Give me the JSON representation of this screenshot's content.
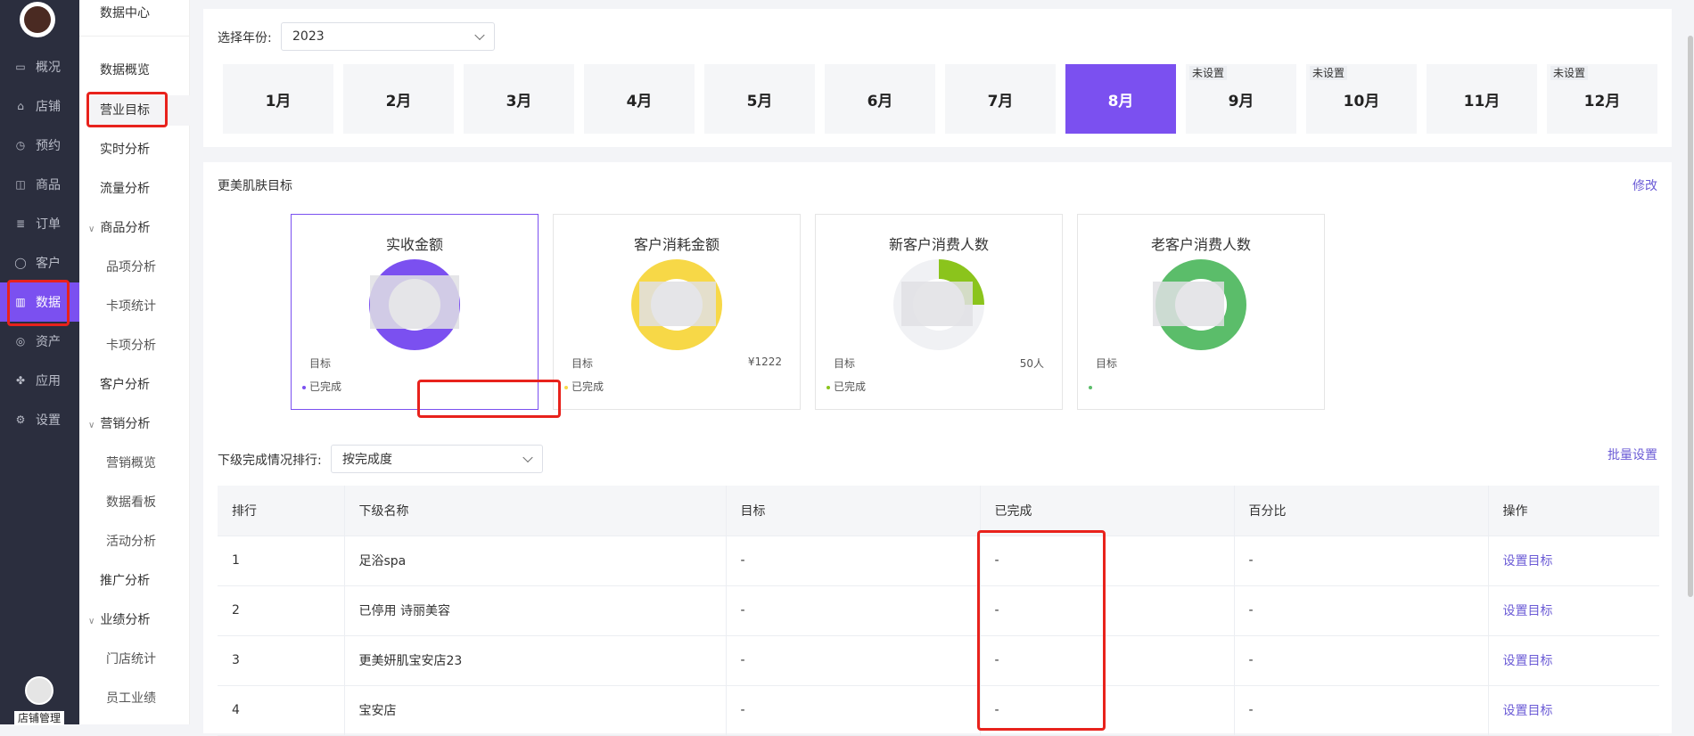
{
  "nav": {
    "items": [
      {
        "label": "概况",
        "icon": "monitor-icon"
      },
      {
        "label": "店铺",
        "icon": "store-icon"
      },
      {
        "label": "预约",
        "icon": "calendar-icon"
      },
      {
        "label": "商品",
        "icon": "bag-icon"
      },
      {
        "label": "订单",
        "icon": "order-icon"
      },
      {
        "label": "客户",
        "icon": "user-icon"
      },
      {
        "label": "数据",
        "icon": "chart-icon"
      },
      {
        "label": "资产",
        "icon": "money-icon"
      },
      {
        "label": "应用",
        "icon": "apps-icon"
      },
      {
        "label": "设置",
        "icon": "gear-icon"
      }
    ],
    "shop_label": "店铺管理"
  },
  "subnav": {
    "title": "数据中心",
    "items": [
      "数据概览",
      "营业目标",
      "实时分析",
      "流量分析",
      "商品分析",
      "品项分析",
      "卡项统计",
      "卡项分析",
      "客户分析",
      "营销分析",
      "营销概览",
      "数据看板",
      "活动分析",
      "推广分析",
      "业绩分析",
      "门店统计",
      "员工业绩"
    ]
  },
  "year": {
    "label": "选择年份:",
    "value": "2023"
  },
  "months": [
    {
      "label": "1月",
      "tag": ""
    },
    {
      "label": "2月",
      "tag": ""
    },
    {
      "label": "3月",
      "tag": ""
    },
    {
      "label": "4月",
      "tag": ""
    },
    {
      "label": "5月",
      "tag": ""
    },
    {
      "label": "6月",
      "tag": ""
    },
    {
      "label": "7月",
      "tag": ""
    },
    {
      "label": "8月",
      "tag": ""
    },
    {
      "label": "9月",
      "tag": "未设置"
    },
    {
      "label": "10月",
      "tag": "未设置"
    },
    {
      "label": "11月",
      "tag": ""
    },
    {
      "label": "12月",
      "tag": "未设置"
    }
  ],
  "goals": {
    "title": "更美肌肤目标",
    "edit": "修改",
    "target_label": "目标",
    "done_label": "已完成",
    "cards": [
      {
        "title": "实收金额",
        "target": "",
        "color": "#7b50f0"
      },
      {
        "title": "客户消耗金额",
        "target": "¥1222",
        "color": "#f7d847"
      },
      {
        "title": "新客户消费人数",
        "target": "50人",
        "color": "#8bc41c"
      },
      {
        "title": "老客户消费人数",
        "target": "",
        "color": "#5bbd6a"
      }
    ]
  },
  "ranking": {
    "label": "下级完成情况排行:",
    "value": "按完成度",
    "batch": "批量设置"
  },
  "table": {
    "headers": [
      "排行",
      "下级名称",
      "目标",
      "已完成",
      "百分比",
      "操作"
    ],
    "rows": [
      {
        "rank": "1",
        "name": "足浴spa",
        "target": "-",
        "done": "-",
        "pct": "-",
        "action": "设置目标"
      },
      {
        "rank": "2",
        "name": "已停用 诗丽美容",
        "target": "-",
        "done": "-",
        "pct": "-",
        "action": "设置目标"
      },
      {
        "rank": "3",
        "name": "更美妍肌宝安店23",
        "target": "-",
        "done": "-",
        "pct": "-",
        "action": "设置目标"
      },
      {
        "rank": "4",
        "name": "宝安店",
        "target": "-",
        "done": "-",
        "pct": "-",
        "action": "设置目标"
      }
    ]
  }
}
